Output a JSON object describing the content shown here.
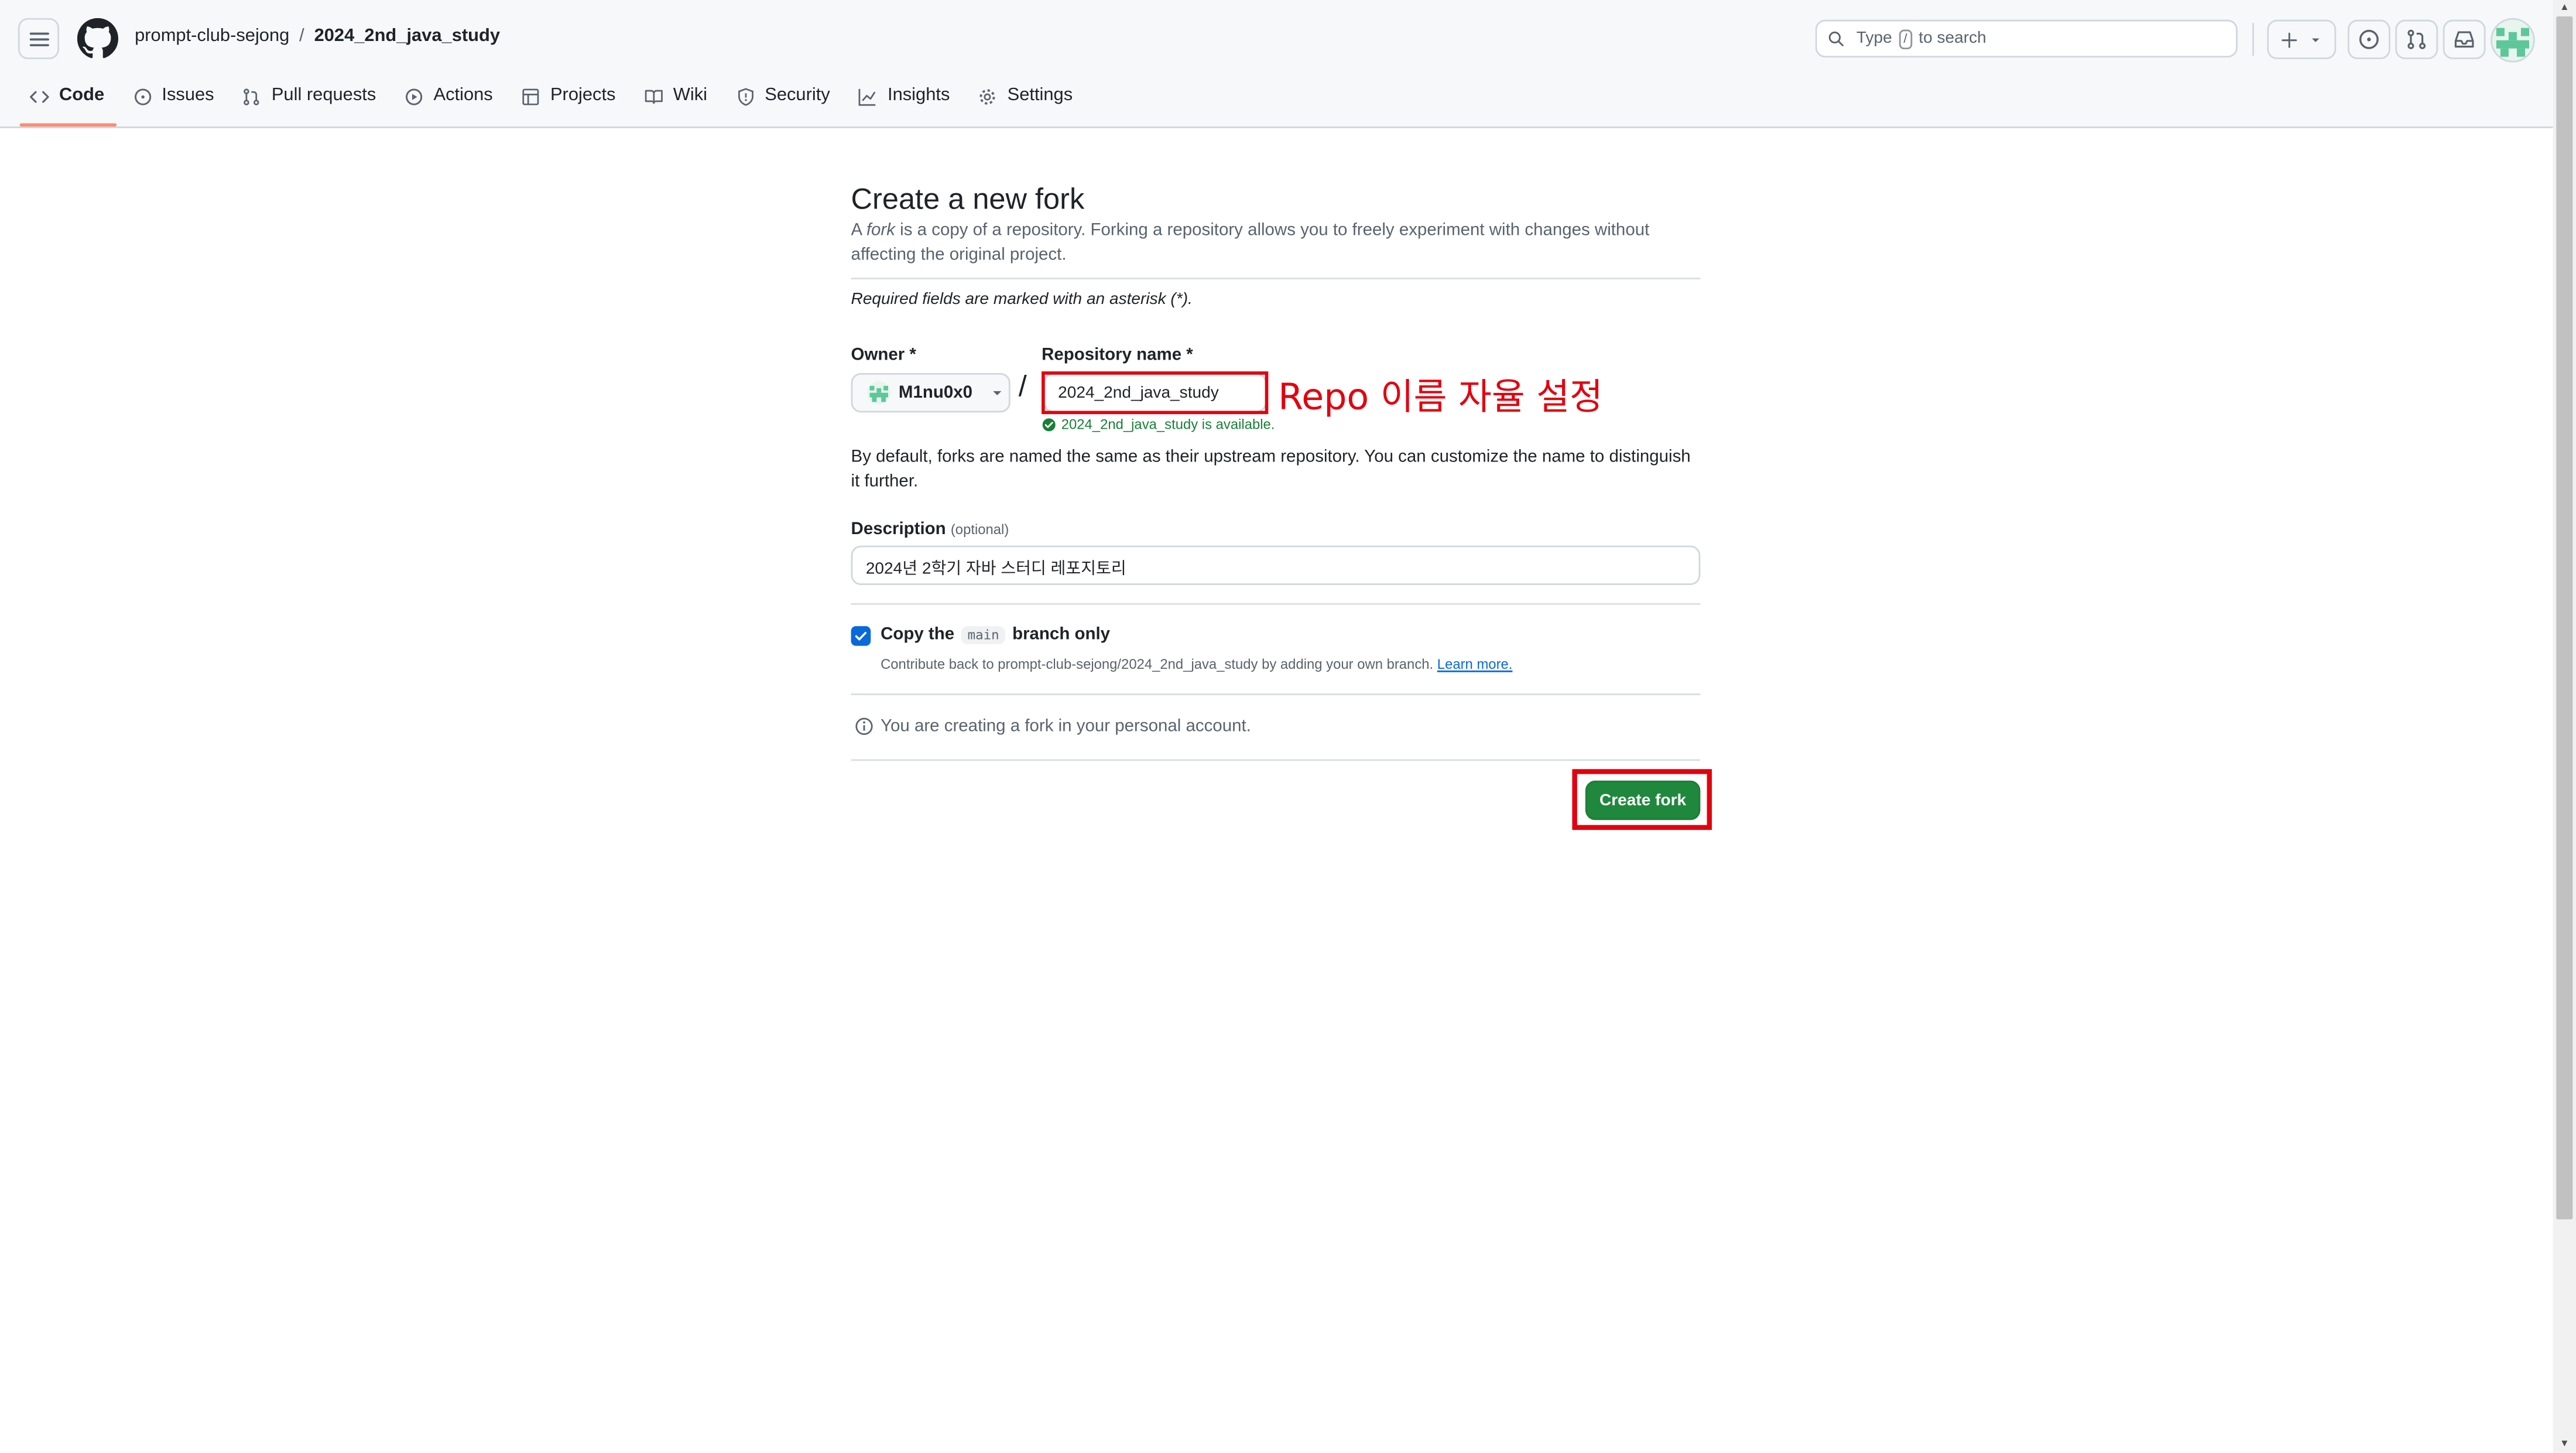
{
  "header": {
    "org": "prompt-club-sejong",
    "separator": "/",
    "repo": "2024_2nd_java_study",
    "search_prefix": "Type",
    "search_key": "/",
    "search_suffix": "to search"
  },
  "tabs": [
    {
      "label": "Code",
      "icon": "code-icon",
      "selected": true
    },
    {
      "label": "Issues",
      "icon": "issue-icon"
    },
    {
      "label": "Pull requests",
      "icon": "pull-request-icon"
    },
    {
      "label": "Actions",
      "icon": "play-icon"
    },
    {
      "label": "Projects",
      "icon": "table-icon"
    },
    {
      "label": "Wiki",
      "icon": "book-icon"
    },
    {
      "label": "Security",
      "icon": "shield-icon"
    },
    {
      "label": "Insights",
      "icon": "graph-icon"
    },
    {
      "label": "Settings",
      "icon": "gear-icon"
    }
  ],
  "form": {
    "title": "Create a new fork",
    "lead_a": "A",
    "lead_fork": "fork",
    "lead_rest": "is a copy of a repository. Forking a repository allows you to freely experiment with changes without affecting the original project.",
    "required_note": "Required fields are marked with an asterisk (*).",
    "owner_label": "Owner *",
    "owner_value": "M1nu0x0",
    "slash": "/",
    "repo_label": "Repository name *",
    "repo_value": "2024_2nd_java_study",
    "availability": "2024_2nd_java_study is available.",
    "naming_note": "By default, forks are named the same as their upstream repository. You can customize the name to distinguish it further.",
    "description_label": "Description",
    "description_optional": "(optional)",
    "description_value": "2024년 2학기 자바 스터디 레포지토리",
    "copy_prefix": "Copy the",
    "copy_branch": "main",
    "copy_suffix": "branch only",
    "copy_checked": true,
    "contribute_text": "Contribute back to prompt-club-sejong/2024_2nd_java_study by adding your own branch.",
    "learn_more": "Learn more.",
    "account_info": "You are creating a fork in your personal account.",
    "create_button": "Create fork"
  },
  "annotation": {
    "text": "Repo 이름 자율 설정",
    "color": "#e3000f"
  },
  "colors": {
    "accent_green": "#1f883d",
    "link_blue": "#0969da",
    "tab_underline": "#fd8c73"
  }
}
